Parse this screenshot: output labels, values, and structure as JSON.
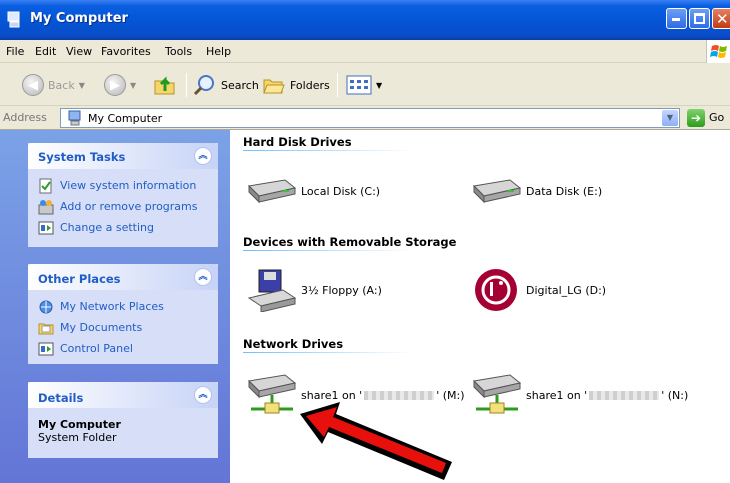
{
  "window": {
    "title": "My Computer"
  },
  "menu": [
    "File",
    "Edit",
    "View",
    "Favorites",
    "Tools",
    "Help"
  ],
  "toolbar": {
    "back_label": "Back",
    "search_label": "Search",
    "folders_label": "Folders"
  },
  "address": {
    "label": "Address",
    "value": "My Computer",
    "go_label": "Go"
  },
  "left": {
    "system_tasks": {
      "title": "System Tasks",
      "items": [
        "View system information",
        "Add or remove programs",
        "Change a setting"
      ]
    },
    "other_places": {
      "title": "Other Places",
      "items": [
        "My Network Places",
        "My Documents",
        "Control Panel"
      ]
    },
    "details": {
      "title": "Details",
      "name": "My Computer",
      "type": "System Folder"
    }
  },
  "groups": {
    "hard_disks": {
      "title": "Hard Disk Drives",
      "drives": [
        "Local Disk (C:)",
        "Data Disk (E:)"
      ]
    },
    "removable": {
      "title": "Devices with Removable Storage",
      "drives": [
        "3½ Floppy (A:)",
        "Digital_LG (D:)"
      ]
    },
    "network": {
      "title": "Network Drives",
      "drives": [
        {
          "prefix": "share1 on '",
          "suffix": "' (M:)"
        },
        {
          "prefix": "share1 on '",
          "suffix": "' (N:)"
        }
      ]
    }
  },
  "colors": {
    "title_blue": "#0455d6",
    "panel_blue": "#7ba2e7",
    "link_blue": "#215dc6",
    "arrow_red": "#e8100d"
  }
}
